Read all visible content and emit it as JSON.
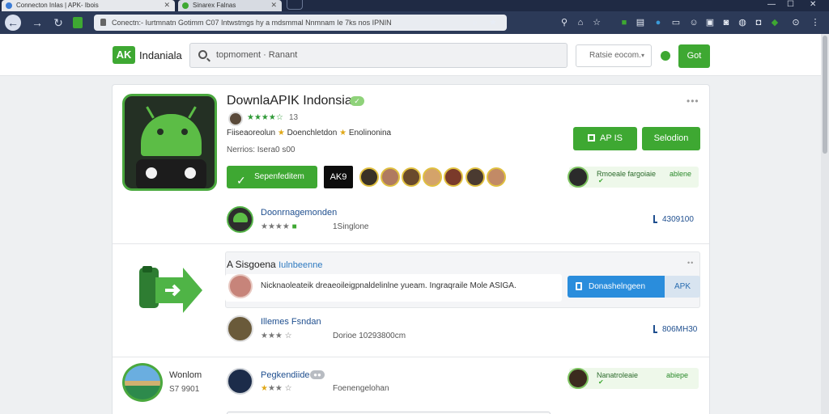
{
  "browser": {
    "tabs": [
      {
        "label": "Connecton Inlas | APK- Ibois",
        "active": true
      },
      {
        "label": "Sinarex Falnas",
        "active": false
      }
    ],
    "address": "Conectn:- Iurtmnatn Gotimm C07 Intwstmgs hy a mdsmmal Nnmnam Ie 7ks nos IPNIN"
  },
  "site": {
    "brand_badge": "AK",
    "brand_name": "Indaniala",
    "search_placeholder": "topmoment · Ranant",
    "select_value": "Ratsie eocom.",
    "go_label": "Got"
  },
  "app": {
    "title": "DownlaAPIK Indonsia",
    "dev_rating_count": "13",
    "tagline_left": "Fiiseaoreolun",
    "tagline_mid": "Doenchletdon",
    "tagline_right": "Enolinonina",
    "version": "Nerrios: Isera0 s00",
    "download_label": "Sepenfeditem",
    "apk_badge": "AK9",
    "apk_button": "AP IS",
    "secondary_button": "Selodion",
    "chip1": {
      "name": "Rmoeale fargoiaie",
      "tag": "ablene"
    }
  },
  "rows": [
    {
      "title": "Doonrnagemonden",
      "meta": "1Singlone",
      "downloads": "4309100"
    },
    {
      "title": "Illemes Fsndan",
      "meta": "Dorioe 10293800cm",
      "downloads": "806MH30"
    },
    {
      "title": "Pegkendiide",
      "meta": "Foenengelohan",
      "chip_name": "Nanatroleaie",
      "chip_tag": "abiepe"
    }
  ],
  "banner": {
    "heading": "A Sisgoena",
    "heading_link": "Iulnbeenne",
    "text": "Nicknaoleateik dreaeoileigpnaldelinlne yueam. Ingraqraile Mole ASIGA.",
    "button": "Donashelngeen",
    "apk": "APK"
  },
  "side": {
    "row3_label": "Wonlom",
    "row3_sub": "S7 9901"
  },
  "colors": {
    "accent_green": "#3ea832",
    "accent_blue": "#2a8ddc",
    "chrome": "#2c3a58"
  },
  "icons": [
    "back-icon",
    "forward-icon",
    "reload-icon",
    "lock-icon",
    "search-icon",
    "star-icon",
    "android-icon",
    "verified-icon",
    "more-icon"
  ]
}
